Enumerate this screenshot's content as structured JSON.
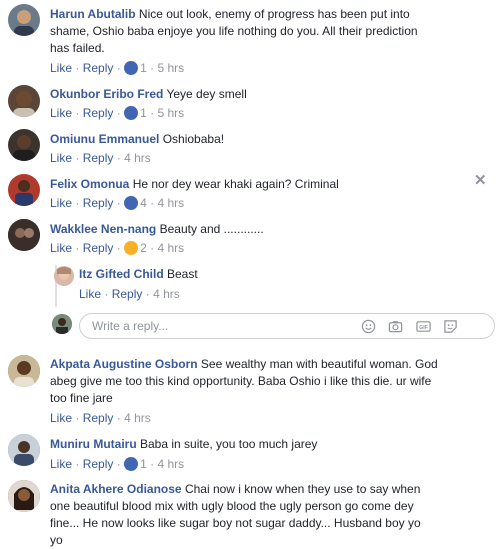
{
  "actions": {
    "like": "Like",
    "reply": "Reply",
    "sep": "·"
  },
  "reply_box": {
    "placeholder": "Write a reply..."
  },
  "comments": [
    {
      "name": "Harun Abutalib",
      "text": "Nice out look, enemy of progress has been put into",
      "text2": "shame, Oshio baba enjoye you life nothing do you. All their prediction",
      "text3": "has failed.",
      "reaction": "like",
      "count": "1",
      "time": "5 hrs",
      "avatar_color": "#6b7a8a"
    },
    {
      "name": "Okunbor Eribo Fred",
      "text": "Yeye dey smell",
      "reaction": "like",
      "count": "1",
      "time": "5 hrs",
      "avatar_color": "#5a4536"
    },
    {
      "name": "Omiunu Emmanuel",
      "text": "Oshiobaba!",
      "time": "4 hrs",
      "avatar_color": "#3b332e"
    },
    {
      "name": "Felix Omonua",
      "text": "He nor dey wear khaki again? Criminal",
      "reaction": "like",
      "count": "4",
      "time": "4 hrs",
      "avatar_color": "#b03a2e"
    },
    {
      "name": "Wakklee Nen-nang",
      "text": "Beauty and ............",
      "reaction": "haha",
      "count": "2",
      "time": "4 hrs",
      "avatar_color": "#4a3f3a"
    },
    {
      "name": "Itz Gifted Child",
      "text": "Beast",
      "time": "4 hrs",
      "avatar_color": "#d8b8a8"
    },
    {
      "name": "Akpata Augustine Osborn",
      "text": "See wealthy man with beautiful woman. God",
      "text2": "abeg give me too this kind opportunity. Baba Oshio i like this die. ur wife",
      "text3": "too fine jare",
      "time": "4 hrs",
      "avatar_color": "#7a5a3a"
    },
    {
      "name": "Muniru Mutairu",
      "text": "Baba in suite, you too much jarey",
      "reaction": "like",
      "count": "1",
      "time": "4 hrs",
      "avatar_color": "#5c6e84"
    },
    {
      "name": "Anita Akhere Odianose",
      "text": "Chai now i know when they use to say when",
      "text2": "one beautiful blood mix with ugly blood the ugly person go come dey",
      "text3": "fine... He now looks like sugar boy not sugar daddy... Husband boy yo",
      "text4": "yo",
      "avatar_color": "#6a4a3a"
    }
  ],
  "colors": {
    "link": "#385898",
    "meta": "#90949c",
    "like": "#4267b2",
    "haha": "#f7b125"
  }
}
